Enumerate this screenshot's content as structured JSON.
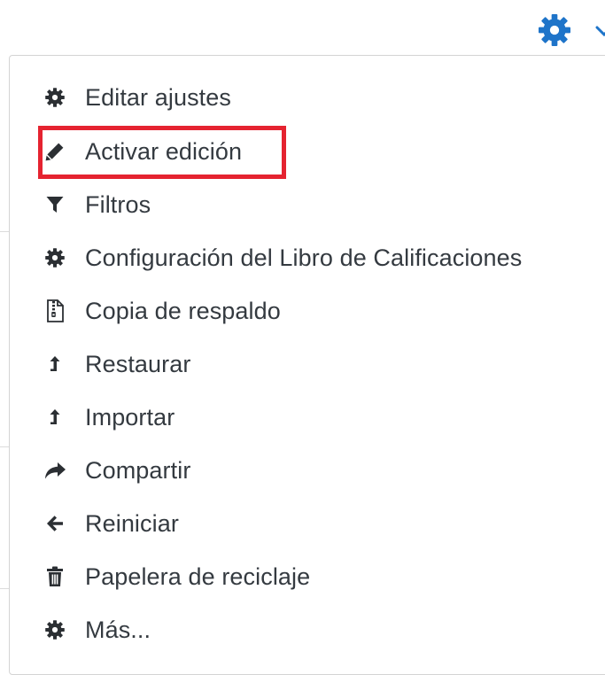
{
  "colors": {
    "accent": "#1e74c9",
    "text": "#343a40",
    "highlight": "#e52330"
  },
  "toolbar": {
    "settings_icon": "gear-icon",
    "toggle_icon": "caret-down-icon"
  },
  "menu": {
    "items": [
      {
        "label": "Editar ajustes",
        "icon": "gear-icon"
      },
      {
        "label": "Activar edición",
        "icon": "pencil-icon"
      },
      {
        "label": "Filtros",
        "icon": "filter-icon"
      },
      {
        "label": "Configuración del Libro de Calificaciones",
        "icon": "gear-icon"
      },
      {
        "label": "Copia de respaldo",
        "icon": "file-archive-icon"
      },
      {
        "label": "Restaurar",
        "icon": "level-up-icon"
      },
      {
        "label": "Importar",
        "icon": "level-up-icon"
      },
      {
        "label": "Compartir",
        "icon": "share-icon"
      },
      {
        "label": "Reiniciar",
        "icon": "arrow-left-icon"
      },
      {
        "label": "Papelera de reciclaje",
        "icon": "trash-icon"
      },
      {
        "label": "Más...",
        "icon": "gear-icon"
      }
    ],
    "highlighted_item": "Activar edición"
  }
}
